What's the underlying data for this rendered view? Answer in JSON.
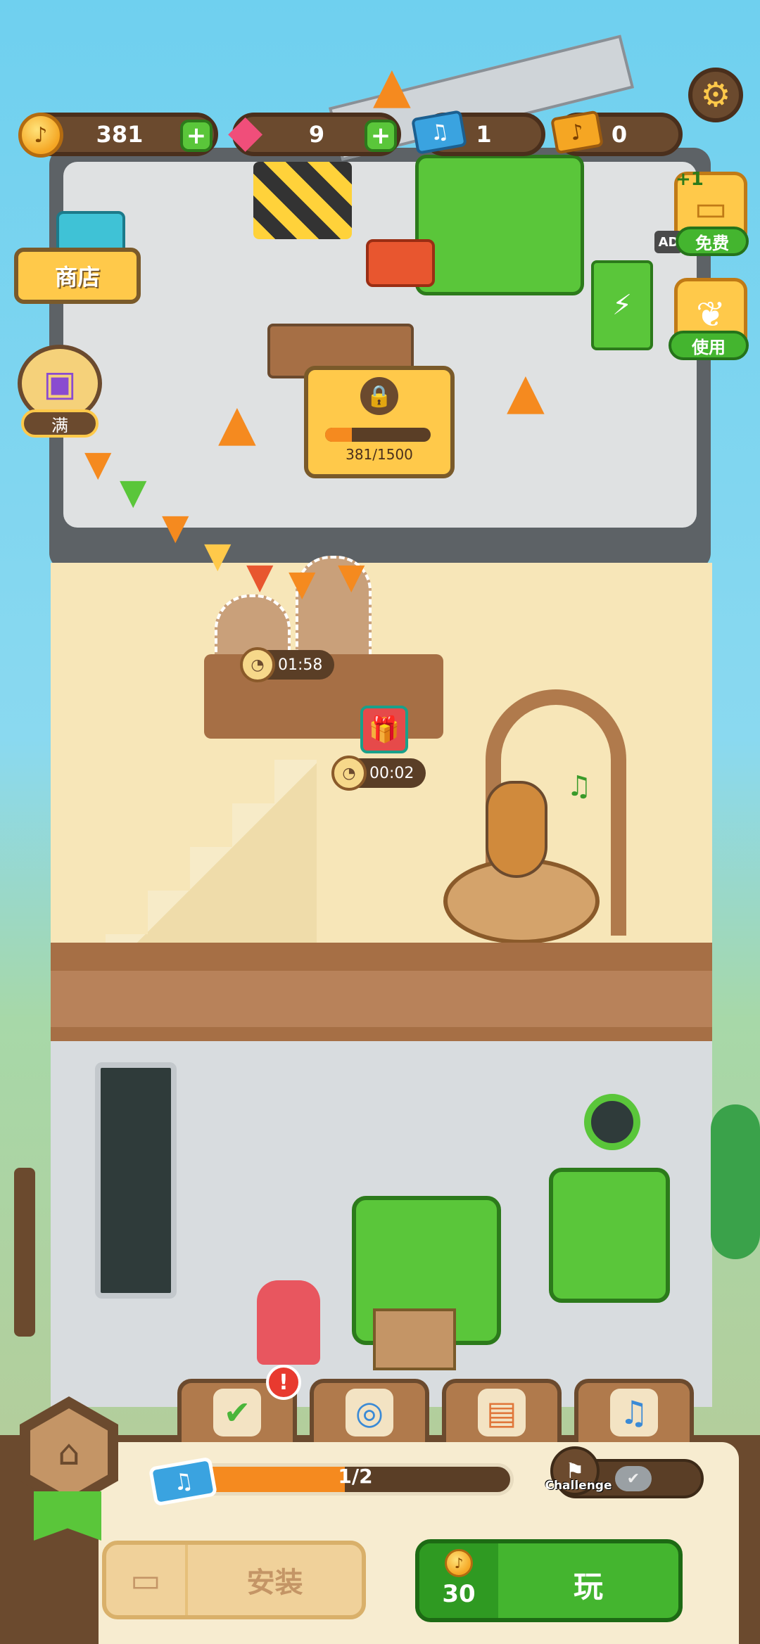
{
  "currency": {
    "notes": {
      "value": "381",
      "icon": "music-note-coin-icon"
    },
    "gems": {
      "value": "9",
      "icon": "gem-icon"
    },
    "blue_tickets": {
      "value": "1",
      "icon": "blue-ticket-icon"
    },
    "gold_tickets": {
      "value": "0",
      "icon": "gold-ticket-icon"
    }
  },
  "left_side": {
    "shop_label": "商店",
    "chest_label": "满"
  },
  "right_side": {
    "free_badge": "+1",
    "ad_label": "AD",
    "free_label": "免费",
    "use_label": "使用"
  },
  "upgrade": {
    "progress_text": "381/1500",
    "progress": 0.254
  },
  "timers": {
    "arch_timer": "01:58",
    "door_timer": "00:02"
  },
  "bottom": {
    "progress_text": "1/2",
    "progress": 0.5,
    "challenge_label": "Challenge",
    "install_label": "安装",
    "play_cost": "30",
    "play_label": "玩"
  },
  "tabs": [
    "checklist-tab",
    "target-tab",
    "notebook-tab",
    "song-list-tab"
  ],
  "colors": {
    "accent_green": "#44b52f",
    "wood_brown": "#6b4a2e",
    "progress_orange": "#f58a1f"
  }
}
